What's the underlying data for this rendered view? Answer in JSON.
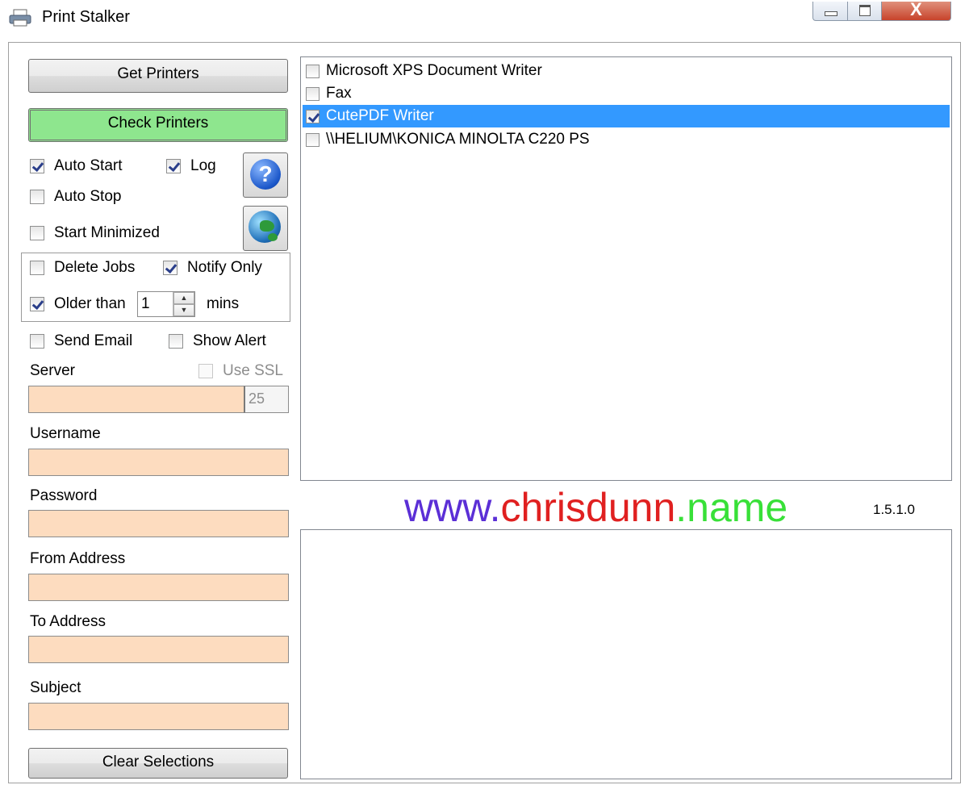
{
  "window": {
    "title": "Print Stalker",
    "close_glyph": "X"
  },
  "buttons": {
    "get_printers": "Get Printers",
    "check_printers": "Check Printers",
    "clear_selections": "Clear Selections"
  },
  "options": {
    "auto_start": {
      "label": "Auto Start",
      "checked": true
    },
    "log": {
      "label": "Log",
      "checked": true
    },
    "auto_stop": {
      "label": "Auto Stop",
      "checked": false
    },
    "start_minimized": {
      "label": "Start Minimized",
      "checked": false
    }
  },
  "jobs": {
    "delete_jobs": {
      "label": "Delete Jobs",
      "checked": false
    },
    "notify_only": {
      "label": "Notify Only",
      "checked": true
    },
    "older_than": {
      "label": "Older than",
      "checked": true
    },
    "minutes_value": "1",
    "mins_label": "mins"
  },
  "email": {
    "send_email": {
      "label": "Send Email",
      "checked": false
    },
    "show_alert": {
      "label": "Show Alert",
      "checked": false
    },
    "use_ssl": {
      "label": "Use SSL",
      "checked": false
    },
    "server_label": "Server",
    "port_value": "25",
    "username_label": "Username",
    "password_label": "Password",
    "from_label": "From Address",
    "to_label": "To Address",
    "subject_label": "Subject"
  },
  "icons": {
    "help": "help-icon",
    "website": "globe-icon",
    "app": "printer-icon"
  },
  "printers": [
    {
      "name": "Microsoft XPS Document Writer",
      "checked": false,
      "selected": false
    },
    {
      "name": "Fax",
      "checked": false,
      "selected": false
    },
    {
      "name": "CutePDF Writer",
      "checked": true,
      "selected": true
    },
    {
      "name": "\\\\HELIUM\\KONICA MINOLTA C220 PS",
      "checked": false,
      "selected": false
    }
  ],
  "banner": {
    "part1": "www.",
    "part2": "chrisdunn",
    "part3": ".name"
  },
  "version": "1.5.1.0",
  "colors": {
    "check_button": "#8ee68e",
    "input_fill": "#fddcbf",
    "selection": "#3399ff"
  }
}
